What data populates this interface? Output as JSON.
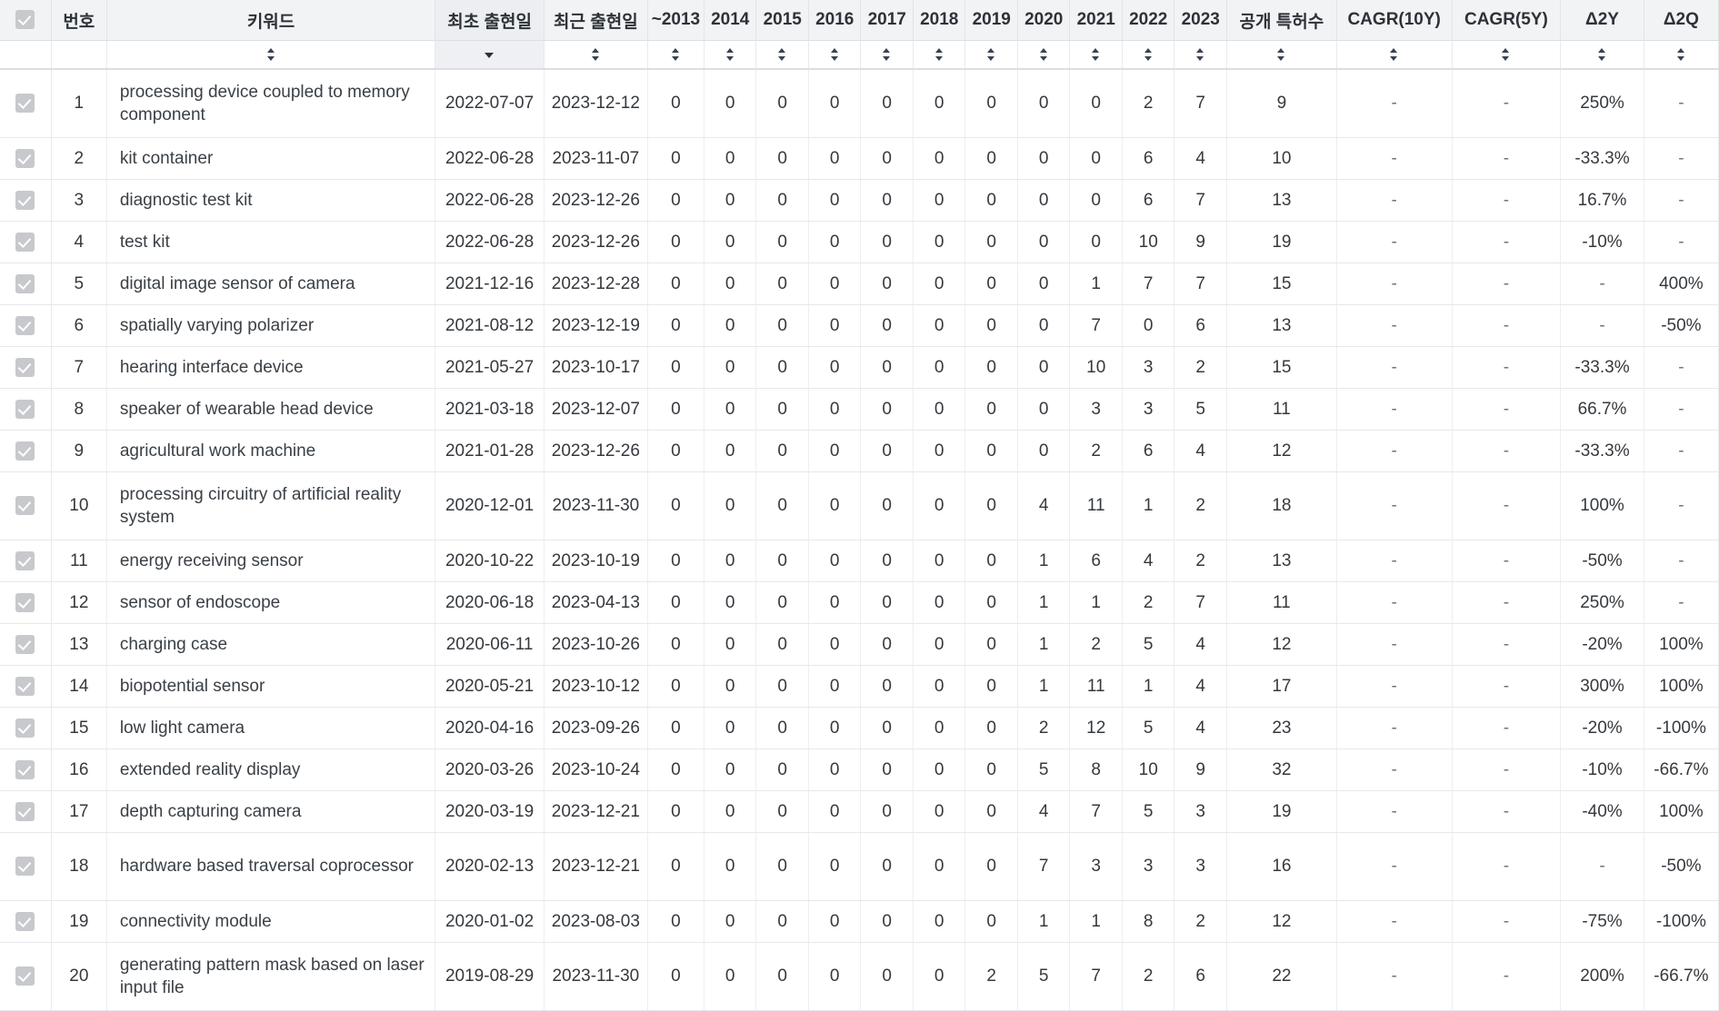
{
  "table": {
    "select_all_icon": "checkbox-checked-icon",
    "columns": [
      {
        "key": "checkbox",
        "label": "",
        "sort": "none"
      },
      {
        "key": "no",
        "label": "번호",
        "sort": "none"
      },
      {
        "key": "keyword",
        "label": "키워드",
        "sort": "both"
      },
      {
        "key": "first_date",
        "label": "최초 출현일",
        "sort": "desc"
      },
      {
        "key": "last_date",
        "label": "최근 출현일",
        "sort": "both"
      },
      {
        "key": "y2013",
        "label": "~2013",
        "sort": "both"
      },
      {
        "key": "y2014",
        "label": "2014",
        "sort": "both"
      },
      {
        "key": "y2015",
        "label": "2015",
        "sort": "both"
      },
      {
        "key": "y2016",
        "label": "2016",
        "sort": "both"
      },
      {
        "key": "y2017",
        "label": "2017",
        "sort": "both"
      },
      {
        "key": "y2018",
        "label": "2018",
        "sort": "both"
      },
      {
        "key": "y2019",
        "label": "2019",
        "sort": "both"
      },
      {
        "key": "y2020",
        "label": "2020",
        "sort": "both"
      },
      {
        "key": "y2021",
        "label": "2021",
        "sort": "both"
      },
      {
        "key": "y2022",
        "label": "2022",
        "sort": "both"
      },
      {
        "key": "y2023",
        "label": "2023",
        "sort": "both"
      },
      {
        "key": "total",
        "label": "공개 특허수",
        "sort": "both"
      },
      {
        "key": "cagr10",
        "label": "CAGR(10Y)",
        "sort": "both"
      },
      {
        "key": "cagr5",
        "label": "CAGR(5Y)",
        "sort": "both"
      },
      {
        "key": "d2y",
        "label": "Δ2Y",
        "sort": "both"
      },
      {
        "key": "d2q",
        "label": "Δ2Q",
        "sort": "both"
      }
    ],
    "rows": [
      {
        "no": "1",
        "keyword": "processing device coupled to memory component",
        "first_date": "2022-07-07",
        "last_date": "2023-12-12",
        "y2013": "0",
        "y2014": "0",
        "y2015": "0",
        "y2016": "0",
        "y2017": "0",
        "y2018": "0",
        "y2019": "0",
        "y2020": "0",
        "y2021": "0",
        "y2022": "2",
        "y2023": "7",
        "total": "9",
        "cagr10": "-",
        "cagr5": "-",
        "d2y": "250%",
        "d2q": "-"
      },
      {
        "no": "2",
        "keyword": "kit container",
        "first_date": "2022-06-28",
        "last_date": "2023-11-07",
        "y2013": "0",
        "y2014": "0",
        "y2015": "0",
        "y2016": "0",
        "y2017": "0",
        "y2018": "0",
        "y2019": "0",
        "y2020": "0",
        "y2021": "0",
        "y2022": "6",
        "y2023": "4",
        "total": "10",
        "cagr10": "-",
        "cagr5": "-",
        "d2y": "-33.3%",
        "d2q": "-"
      },
      {
        "no": "3",
        "keyword": "diagnostic test kit",
        "first_date": "2022-06-28",
        "last_date": "2023-12-26",
        "y2013": "0",
        "y2014": "0",
        "y2015": "0",
        "y2016": "0",
        "y2017": "0",
        "y2018": "0",
        "y2019": "0",
        "y2020": "0",
        "y2021": "0",
        "y2022": "6",
        "y2023": "7",
        "total": "13",
        "cagr10": "-",
        "cagr5": "-",
        "d2y": "16.7%",
        "d2q": "-"
      },
      {
        "no": "4",
        "keyword": "test kit",
        "first_date": "2022-06-28",
        "last_date": "2023-12-26",
        "y2013": "0",
        "y2014": "0",
        "y2015": "0",
        "y2016": "0",
        "y2017": "0",
        "y2018": "0",
        "y2019": "0",
        "y2020": "0",
        "y2021": "0",
        "y2022": "10",
        "y2023": "9",
        "total": "19",
        "cagr10": "-",
        "cagr5": "-",
        "d2y": "-10%",
        "d2q": "-"
      },
      {
        "no": "5",
        "keyword": "digital image sensor of camera",
        "first_date": "2021-12-16",
        "last_date": "2023-12-28",
        "y2013": "0",
        "y2014": "0",
        "y2015": "0",
        "y2016": "0",
        "y2017": "0",
        "y2018": "0",
        "y2019": "0",
        "y2020": "0",
        "y2021": "1",
        "y2022": "7",
        "y2023": "7",
        "total": "15",
        "cagr10": "-",
        "cagr5": "-",
        "d2y": "-",
        "d2q": "400%"
      },
      {
        "no": "6",
        "keyword": "spatially varying polarizer",
        "first_date": "2021-08-12",
        "last_date": "2023-12-19",
        "y2013": "0",
        "y2014": "0",
        "y2015": "0",
        "y2016": "0",
        "y2017": "0",
        "y2018": "0",
        "y2019": "0",
        "y2020": "0",
        "y2021": "7",
        "y2022": "0",
        "y2023": "6",
        "total": "13",
        "cagr10": "-",
        "cagr5": "-",
        "d2y": "-",
        "d2q": "-50%"
      },
      {
        "no": "7",
        "keyword": "hearing interface device",
        "first_date": "2021-05-27",
        "last_date": "2023-10-17",
        "y2013": "0",
        "y2014": "0",
        "y2015": "0",
        "y2016": "0",
        "y2017": "0",
        "y2018": "0",
        "y2019": "0",
        "y2020": "0",
        "y2021": "10",
        "y2022": "3",
        "y2023": "2",
        "total": "15",
        "cagr10": "-",
        "cagr5": "-",
        "d2y": "-33.3%",
        "d2q": "-"
      },
      {
        "no": "8",
        "keyword": "speaker of wearable head device",
        "first_date": "2021-03-18",
        "last_date": "2023-12-07",
        "y2013": "0",
        "y2014": "0",
        "y2015": "0",
        "y2016": "0",
        "y2017": "0",
        "y2018": "0",
        "y2019": "0",
        "y2020": "0",
        "y2021": "3",
        "y2022": "3",
        "y2023": "5",
        "total": "11",
        "cagr10": "-",
        "cagr5": "-",
        "d2y": "66.7%",
        "d2q": "-"
      },
      {
        "no": "9",
        "keyword": "agricultural work machine",
        "first_date": "2021-01-28",
        "last_date": "2023-12-26",
        "y2013": "0",
        "y2014": "0",
        "y2015": "0",
        "y2016": "0",
        "y2017": "0",
        "y2018": "0",
        "y2019": "0",
        "y2020": "0",
        "y2021": "2",
        "y2022": "6",
        "y2023": "4",
        "total": "12",
        "cagr10": "-",
        "cagr5": "-",
        "d2y": "-33.3%",
        "d2q": "-"
      },
      {
        "no": "10",
        "keyword": "processing circuitry of artificial reality system",
        "first_date": "2020-12-01",
        "last_date": "2023-11-30",
        "y2013": "0",
        "y2014": "0",
        "y2015": "0",
        "y2016": "0",
        "y2017": "0",
        "y2018": "0",
        "y2019": "0",
        "y2020": "4",
        "y2021": "11",
        "y2022": "1",
        "y2023": "2",
        "total": "18",
        "cagr10": "-",
        "cagr5": "-",
        "d2y": "100%",
        "d2q": "-"
      },
      {
        "no": "11",
        "keyword": "energy receiving sensor",
        "first_date": "2020-10-22",
        "last_date": "2023-10-19",
        "y2013": "0",
        "y2014": "0",
        "y2015": "0",
        "y2016": "0",
        "y2017": "0",
        "y2018": "0",
        "y2019": "0",
        "y2020": "1",
        "y2021": "6",
        "y2022": "4",
        "y2023": "2",
        "total": "13",
        "cagr10": "-",
        "cagr5": "-",
        "d2y": "-50%",
        "d2q": "-"
      },
      {
        "no": "12",
        "keyword": "sensor of endoscope",
        "first_date": "2020-06-18",
        "last_date": "2023-04-13",
        "y2013": "0",
        "y2014": "0",
        "y2015": "0",
        "y2016": "0",
        "y2017": "0",
        "y2018": "0",
        "y2019": "0",
        "y2020": "1",
        "y2021": "1",
        "y2022": "2",
        "y2023": "7",
        "total": "11",
        "cagr10": "-",
        "cagr5": "-",
        "d2y": "250%",
        "d2q": "-"
      },
      {
        "no": "13",
        "keyword": "charging case",
        "first_date": "2020-06-11",
        "last_date": "2023-10-26",
        "y2013": "0",
        "y2014": "0",
        "y2015": "0",
        "y2016": "0",
        "y2017": "0",
        "y2018": "0",
        "y2019": "0",
        "y2020": "1",
        "y2021": "2",
        "y2022": "5",
        "y2023": "4",
        "total": "12",
        "cagr10": "-",
        "cagr5": "-",
        "d2y": "-20%",
        "d2q": "100%"
      },
      {
        "no": "14",
        "keyword": "biopotential sensor",
        "first_date": "2020-05-21",
        "last_date": "2023-10-12",
        "y2013": "0",
        "y2014": "0",
        "y2015": "0",
        "y2016": "0",
        "y2017": "0",
        "y2018": "0",
        "y2019": "0",
        "y2020": "1",
        "y2021": "11",
        "y2022": "1",
        "y2023": "4",
        "total": "17",
        "cagr10": "-",
        "cagr5": "-",
        "d2y": "300%",
        "d2q": "100%"
      },
      {
        "no": "15",
        "keyword": "low light camera",
        "first_date": "2020-04-16",
        "last_date": "2023-09-26",
        "y2013": "0",
        "y2014": "0",
        "y2015": "0",
        "y2016": "0",
        "y2017": "0",
        "y2018": "0",
        "y2019": "0",
        "y2020": "2",
        "y2021": "12",
        "y2022": "5",
        "y2023": "4",
        "total": "23",
        "cagr10": "-",
        "cagr5": "-",
        "d2y": "-20%",
        "d2q": "-100%"
      },
      {
        "no": "16",
        "keyword": "extended reality display",
        "first_date": "2020-03-26",
        "last_date": "2023-10-24",
        "y2013": "0",
        "y2014": "0",
        "y2015": "0",
        "y2016": "0",
        "y2017": "0",
        "y2018": "0",
        "y2019": "0",
        "y2020": "5",
        "y2021": "8",
        "y2022": "10",
        "y2023": "9",
        "total": "32",
        "cagr10": "-",
        "cagr5": "-",
        "d2y": "-10%",
        "d2q": "-66.7%"
      },
      {
        "no": "17",
        "keyword": "depth capturing camera",
        "first_date": "2020-03-19",
        "last_date": "2023-12-21",
        "y2013": "0",
        "y2014": "0",
        "y2015": "0",
        "y2016": "0",
        "y2017": "0",
        "y2018": "0",
        "y2019": "0",
        "y2020": "4",
        "y2021": "7",
        "y2022": "5",
        "y2023": "3",
        "total": "19",
        "cagr10": "-",
        "cagr5": "-",
        "d2y": "-40%",
        "d2q": "100%"
      },
      {
        "no": "18",
        "keyword": "hardware based traversal coprocessor",
        "first_date": "2020-02-13",
        "last_date": "2023-12-21",
        "y2013": "0",
        "y2014": "0",
        "y2015": "0",
        "y2016": "0",
        "y2017": "0",
        "y2018": "0",
        "y2019": "0",
        "y2020": "7",
        "y2021": "3",
        "y2022": "3",
        "y2023": "3",
        "total": "16",
        "cagr10": "-",
        "cagr5": "-",
        "d2y": "-",
        "d2q": "-50%"
      },
      {
        "no": "19",
        "keyword": "connectivity module",
        "first_date": "2020-01-02",
        "last_date": "2023-08-03",
        "y2013": "0",
        "y2014": "0",
        "y2015": "0",
        "y2016": "0",
        "y2017": "0",
        "y2018": "0",
        "y2019": "0",
        "y2020": "1",
        "y2021": "1",
        "y2022": "8",
        "y2023": "2",
        "total": "12",
        "cagr10": "-",
        "cagr5": "-",
        "d2y": "-75%",
        "d2q": "-100%"
      },
      {
        "no": "20",
        "keyword": "generating pattern mask based on laser input file",
        "first_date": "2019-08-29",
        "last_date": "2023-11-30",
        "y2013": "0",
        "y2014": "0",
        "y2015": "0",
        "y2016": "0",
        "y2017": "0",
        "y2018": "0",
        "y2019": "2",
        "y2020": "5",
        "y2021": "7",
        "y2022": "2",
        "y2023": "6",
        "total": "22",
        "cagr10": "-",
        "cagr5": "-",
        "d2y": "200%",
        "d2q": "-66.7%"
      }
    ]
  }
}
